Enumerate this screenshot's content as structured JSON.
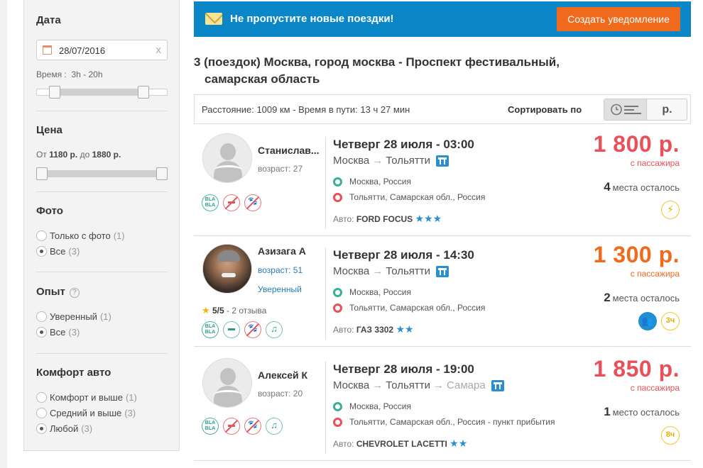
{
  "sidebar": {
    "date": {
      "title": "Дата",
      "value": "28/07/2016",
      "clear": "x",
      "time_label": "Время :",
      "time_range": "3h - 20h"
    },
    "price": {
      "title": "Цена",
      "from_label": "От",
      "from": "1180 р.",
      "to_label": "до",
      "to": "1880 р."
    },
    "photo": {
      "title": "Фото",
      "options": [
        {
          "label": "Только с фото",
          "count": "(1)",
          "selected": false
        },
        {
          "label": "Все",
          "count": "(3)",
          "selected": true
        }
      ]
    },
    "experience": {
      "title": "Опыт",
      "help": "?",
      "options": [
        {
          "label": "Уверенный",
          "count": "(1)",
          "selected": false
        },
        {
          "label": "Все",
          "count": "(3)",
          "selected": true
        }
      ]
    },
    "comfort": {
      "title": "Комфорт авто",
      "options": [
        {
          "label": "Комфорт и выше",
          "count": "(1)",
          "selected": false
        },
        {
          "label": "Средний и выше",
          "count": "(3)",
          "selected": false
        },
        {
          "label": "Любой",
          "count": "(3)",
          "selected": true
        }
      ]
    }
  },
  "banner": {
    "text": "Не пропустите новые поездки!",
    "button": "Создать уведомление"
  },
  "results": {
    "title_line1": "3 (поездок) Москва, город москва - Проспект фестивальный,",
    "title_line2": "самарская область"
  },
  "sortbar": {
    "info": "Расстояние: 1009 км - Время в пути: 13 ч 27 мин",
    "sort_label": "Сортировать по",
    "price_option": "р."
  },
  "trips": [
    {
      "driver": "Станислав...",
      "age": "возраст: 27",
      "date": "Четверг 28 июля - 03:00",
      "from": "Москва",
      "arrow": "→",
      "to": "Тольятти",
      "stop_start": "Москва, Россия",
      "stop_end": "Тольятти, Самарская обл., Россия",
      "car_label": "Авто:",
      "car": "FORD FOCUS",
      "car_stars": "★★★",
      "price": "1 800 р.",
      "per_passenger": "с пассажира",
      "seats_num": "4",
      "seats_text": "места осталось",
      "badge": "⚡"
    },
    {
      "driver": "Азизага А",
      "age": "возраст: 51",
      "experience": "Уверенный",
      "rating_star": "★",
      "rating": "5/5",
      "reviews": "- 2 отзыва",
      "date": "Четверг 28 июля - 14:30",
      "from": "Москва",
      "arrow": "→",
      "to": "Тольятти",
      "stop_start": "Москва, Россия",
      "stop_end": "Тольятти, Самарская обл., Россия",
      "car_label": "Авто:",
      "car": "ГАЗ 3302",
      "car_stars": "★★",
      "price": "1 300 р.",
      "per_passenger": "с пассажира",
      "seats_num": "2",
      "seats_text": "места осталось",
      "badge": "3ч"
    },
    {
      "driver": "Алексей К",
      "age": "возраст: 20",
      "date": "Четверг 28 июля - 19:00",
      "from": "Москва",
      "arrow": "→",
      "to": "Тольятти",
      "arrow2": "→",
      "to2": "Самара",
      "stop_start": "Москва, Россия",
      "stop_end": "Тольятти, Самарская обл., Россия - пункт прибытия",
      "car_label": "Авто:",
      "car": "CHEVROLET LACETTI",
      "car_stars": "★★",
      "price": "1 850 р.",
      "per_passenger": "с пассажира",
      "seats_num": "1",
      "seats_text": "место осталось",
      "badge": "8ч"
    }
  ],
  "prefs_icons": [
    "blabla-icon",
    "no-smoking-icon",
    "no-pets-icon",
    "music-icon"
  ],
  "colors": {
    "banner": "#0b87c8",
    "cta": "#f06a1d",
    "price_red": "#e8505b",
    "price_orange": "#f06a1d",
    "accent_blue": "#2b8fcf"
  }
}
